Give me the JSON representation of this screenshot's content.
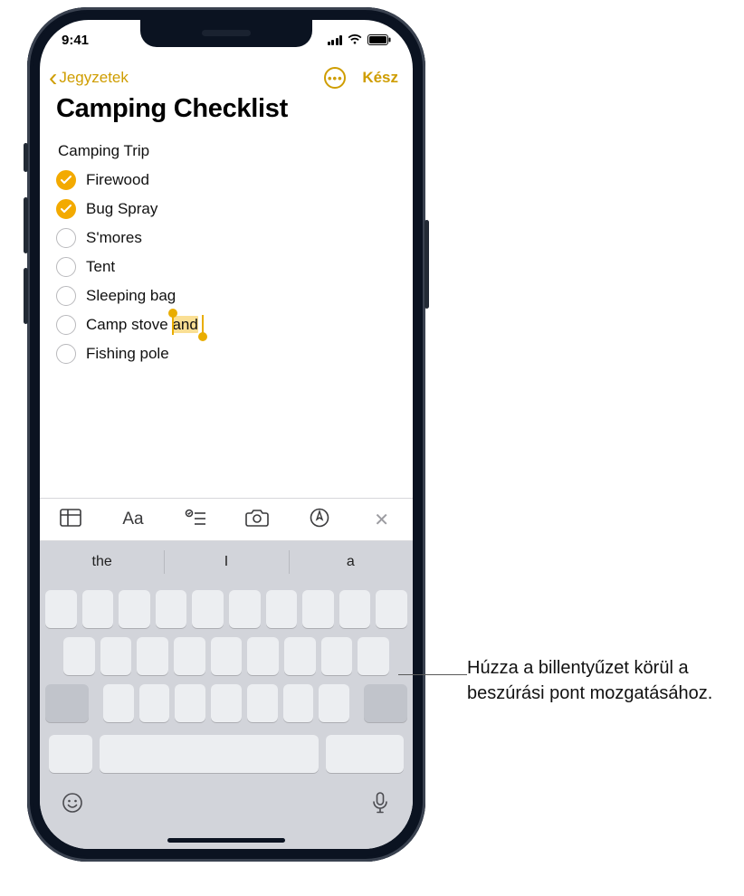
{
  "status": {
    "time": "9:41"
  },
  "nav": {
    "back_label": "Jegyzetek",
    "done_label": "Kész"
  },
  "note": {
    "title": "Camping Checklist",
    "section": "Camping Trip",
    "items": [
      {
        "label": "Firewood",
        "checked": true
      },
      {
        "label": "Bug Spray",
        "checked": true
      },
      {
        "label": "S'mores",
        "checked": false
      },
      {
        "label": "Tent",
        "checked": false
      },
      {
        "label": "Sleeping bag",
        "checked": false
      },
      {
        "label": "Camp stove ",
        "checked": false,
        "selected_suffix": "and"
      },
      {
        "label": "Fishing pole",
        "checked": false
      }
    ]
  },
  "toolbar": {
    "table": "table-icon",
    "format": "Aa",
    "checklist": "checklist-icon",
    "camera": "camera-icon",
    "markup": "markup-icon",
    "close": "✕"
  },
  "predictive": {
    "0": "the",
    "1": "I",
    "2": "a"
  },
  "callout": "Húzza a billentyűzet körül a beszúrási pont mozgatásához.",
  "colors": {
    "accent": "#cf9d00",
    "check": "#f3aa00"
  }
}
